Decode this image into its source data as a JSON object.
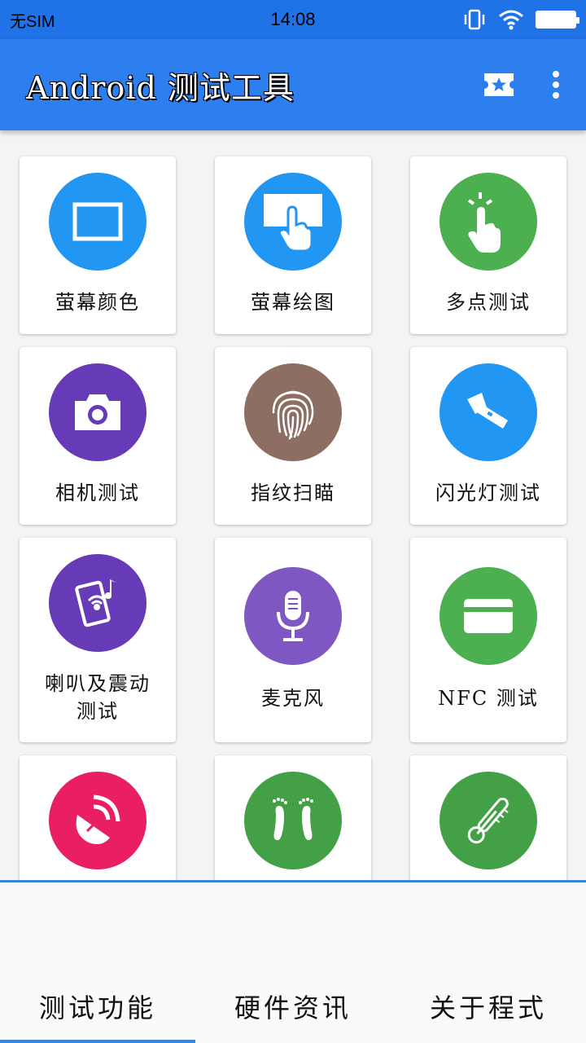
{
  "status_bar": {
    "carrier": "无SIM",
    "time": "14:08"
  },
  "app_bar": {
    "title": "Android 测试工具"
  },
  "tiles": [
    {
      "label": "萤幕颜色",
      "icon": "screen-rectangle-icon",
      "color": "#2196f3"
    },
    {
      "label": "萤幕绘图",
      "icon": "touch-draw-icon",
      "color": "#2196f3"
    },
    {
      "label": "多点测试",
      "icon": "tap-gesture-icon",
      "color": "#4caf50"
    },
    {
      "label": "相机测试",
      "icon": "camera-icon",
      "color": "#673ab7"
    },
    {
      "label": "指纹扫瞄",
      "icon": "fingerprint-icon",
      "color": "#8d6e63"
    },
    {
      "label": "闪光灯测试",
      "icon": "flashlight-icon",
      "color": "#2196f3"
    },
    {
      "label_line1": "喇叭及震动",
      "label_line2": "测试",
      "icon": "phone-sound-icon",
      "color": "#673ab7"
    },
    {
      "label": "麦克风",
      "icon": "microphone-icon",
      "color": "#7e57c2"
    },
    {
      "label": "NFC 测试",
      "icon": "card-icon",
      "color": "#4caf50"
    },
    {
      "icon": "satellite-dish-icon",
      "color": "#e91e63"
    },
    {
      "icon": "footprints-icon",
      "color": "#43a047"
    },
    {
      "icon": "thermometer-icon",
      "color": "#43a047"
    }
  ],
  "tabs": [
    {
      "label": "测试功能",
      "active": true
    },
    {
      "label": "硬件资讯",
      "active": false
    },
    {
      "label": "关于程式",
      "active": false
    }
  ]
}
